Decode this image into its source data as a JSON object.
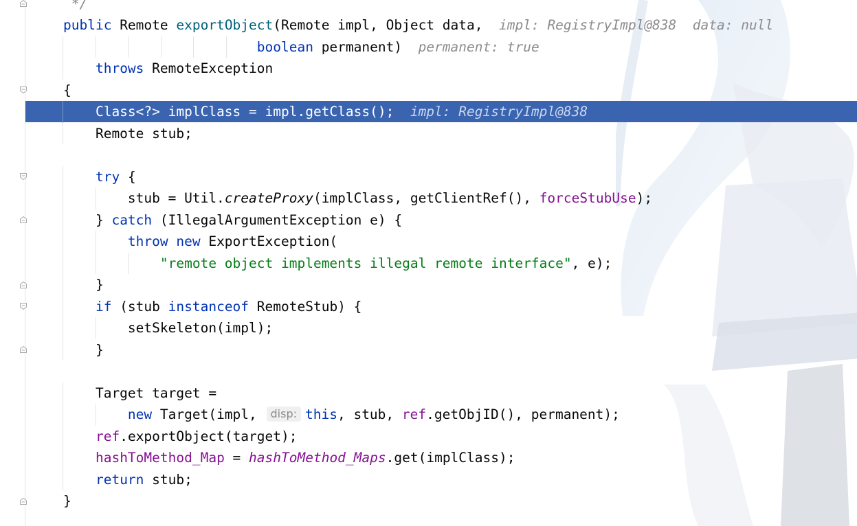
{
  "editor": {
    "lines": [
      {
        "tokens": [
          {
            "t": " */",
            "c": "hint"
          }
        ]
      },
      {
        "tokens": [
          {
            "t": "public ",
            "c": "kw"
          },
          {
            "t": "Remote ",
            "c": ""
          },
          {
            "t": "exportObject",
            "c": "mth"
          },
          {
            "t": "(Remote impl, Object data,  ",
            "c": ""
          },
          {
            "t": "impl: RegistryImpl@838  data: null",
            "c": "hint"
          }
        ]
      },
      {
        "tokens": [
          {
            "t": "                        ",
            "c": ""
          },
          {
            "t": "boolean ",
            "c": "kw"
          },
          {
            "t": "permanent)  ",
            "c": ""
          },
          {
            "t": "permanent: true",
            "c": "hint"
          }
        ]
      },
      {
        "tokens": [
          {
            "t": "    ",
            "c": ""
          },
          {
            "t": "throws ",
            "c": "kw"
          },
          {
            "t": "RemoteException",
            "c": ""
          }
        ]
      },
      {
        "tokens": [
          {
            "t": "{",
            "c": ""
          }
        ]
      },
      {
        "tokens": [
          {
            "t": "    Class<?> implClass = impl.getClass();  ",
            "c": ""
          },
          {
            "t": "impl: RegistryImpl@838",
            "c": "hint"
          }
        ],
        "current": true
      },
      {
        "tokens": [
          {
            "t": "    Remote stub;",
            "c": ""
          }
        ]
      },
      {
        "tokens": []
      },
      {
        "tokens": [
          {
            "t": "    ",
            "c": ""
          },
          {
            "t": "try",
            "c": "kw"
          },
          {
            "t": " {",
            "c": ""
          }
        ]
      },
      {
        "tokens": [
          {
            "t": "        stub = Util.",
            "c": ""
          },
          {
            "t": "createProxy",
            "c": "smth"
          },
          {
            "t": "(implClass, getClientRef(), ",
            "c": ""
          },
          {
            "t": "forceStubUse",
            "c": "fld"
          },
          {
            "t": ");",
            "c": ""
          }
        ]
      },
      {
        "tokens": [
          {
            "t": "    } ",
            "c": ""
          },
          {
            "t": "catch",
            "c": "kw"
          },
          {
            "t": " (IllegalArgumentException e) {",
            "c": ""
          }
        ]
      },
      {
        "tokens": [
          {
            "t": "        ",
            "c": ""
          },
          {
            "t": "throw new ",
            "c": "kw"
          },
          {
            "t": "ExportException(",
            "c": ""
          }
        ]
      },
      {
        "tokens": [
          {
            "t": "            ",
            "c": ""
          },
          {
            "t": "\"remote object implements illegal remote interface\"",
            "c": "str"
          },
          {
            "t": ", e);",
            "c": ""
          }
        ]
      },
      {
        "tokens": [
          {
            "t": "    }",
            "c": ""
          }
        ]
      },
      {
        "tokens": [
          {
            "t": "    ",
            "c": ""
          },
          {
            "t": "if",
            "c": "kw"
          },
          {
            "t": " (stub ",
            "c": ""
          },
          {
            "t": "instanceof ",
            "c": "kw"
          },
          {
            "t": "RemoteStub) {",
            "c": ""
          }
        ]
      },
      {
        "tokens": [
          {
            "t": "        setSkeleton(impl);",
            "c": ""
          }
        ]
      },
      {
        "tokens": [
          {
            "t": "    }",
            "c": ""
          }
        ]
      },
      {
        "tokens": []
      },
      {
        "tokens": [
          {
            "t": "    Target target =",
            "c": ""
          }
        ]
      },
      {
        "tokens": [
          {
            "t": "        ",
            "c": ""
          },
          {
            "t": "new ",
            "c": "kw"
          },
          {
            "t": "Target(impl, ",
            "c": ""
          },
          {
            "t": "disp:",
            "c": "param"
          },
          {
            "t": "this",
            "c": "kw"
          },
          {
            "t": ", stub, ",
            "c": ""
          },
          {
            "t": "ref",
            "c": "fld"
          },
          {
            "t": ".getObjID(), permanent);",
            "c": ""
          }
        ]
      },
      {
        "tokens": [
          {
            "t": "    ",
            "c": ""
          },
          {
            "t": "ref",
            "c": "fld"
          },
          {
            "t": ".exportObject(target);",
            "c": ""
          }
        ]
      },
      {
        "tokens": [
          {
            "t": "    ",
            "c": ""
          },
          {
            "t": "hashToMethod_Map",
            "c": "fld"
          },
          {
            "t": " = ",
            "c": ""
          },
          {
            "t": "hashToMethod_Maps",
            "c": "sfld"
          },
          {
            "t": ".get(implClass);",
            "c": ""
          }
        ]
      },
      {
        "tokens": [
          {
            "t": "    ",
            "c": ""
          },
          {
            "t": "return ",
            "c": "kw"
          },
          {
            "t": "stub;",
            "c": ""
          }
        ]
      },
      {
        "tokens": [
          {
            "t": "}",
            "c": ""
          }
        ]
      }
    ]
  },
  "colors": {
    "current_line": "#3a64b0",
    "keyword": "#0033b3",
    "method": "#00627a",
    "field": "#871094",
    "string": "#067d17",
    "hint": "#8c8c8c"
  },
  "gutter": {
    "fold_markers": [
      {
        "line": 0,
        "kind": "end"
      },
      {
        "line": 4,
        "kind": "start"
      },
      {
        "line": 8,
        "kind": "start"
      },
      {
        "line": 10,
        "kind": "end"
      },
      {
        "line": 13,
        "kind": "end"
      },
      {
        "line": 14,
        "kind": "start"
      },
      {
        "line": 16,
        "kind": "end"
      },
      {
        "line": 23,
        "kind": "end"
      }
    ]
  }
}
